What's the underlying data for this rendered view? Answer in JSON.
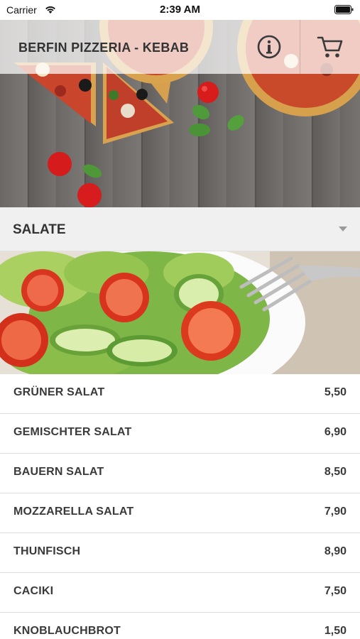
{
  "status_bar": {
    "carrier": "Carrier",
    "time": "2:39 AM"
  },
  "header": {
    "title": "BERFIN PIZZERIA - KEBAB",
    "info_icon": "info-icon",
    "cart_icon": "cart-icon"
  },
  "category": {
    "title": "SALATE",
    "expand_icon": "caret-down-icon"
  },
  "menu": {
    "items": [
      {
        "name": "GRÜNER SALAT",
        "price": "5,50"
      },
      {
        "name": "GEMISCHTER SALAT",
        "price": "6,90"
      },
      {
        "name": "BAUERN SALAT",
        "price": "8,50"
      },
      {
        "name": "MOZZARELLA SALAT",
        "price": "7,90"
      },
      {
        "name": "THUNFISCH",
        "price": "8,90"
      },
      {
        "name": "CACIKI",
        "price": "7,50"
      },
      {
        "name": "KNOBLAUCHBROT",
        "price": "1,50"
      }
    ]
  },
  "colors": {
    "header_overlay": "#ffffff",
    "category_bar": "#f0f0f0",
    "text": "#333333"
  }
}
